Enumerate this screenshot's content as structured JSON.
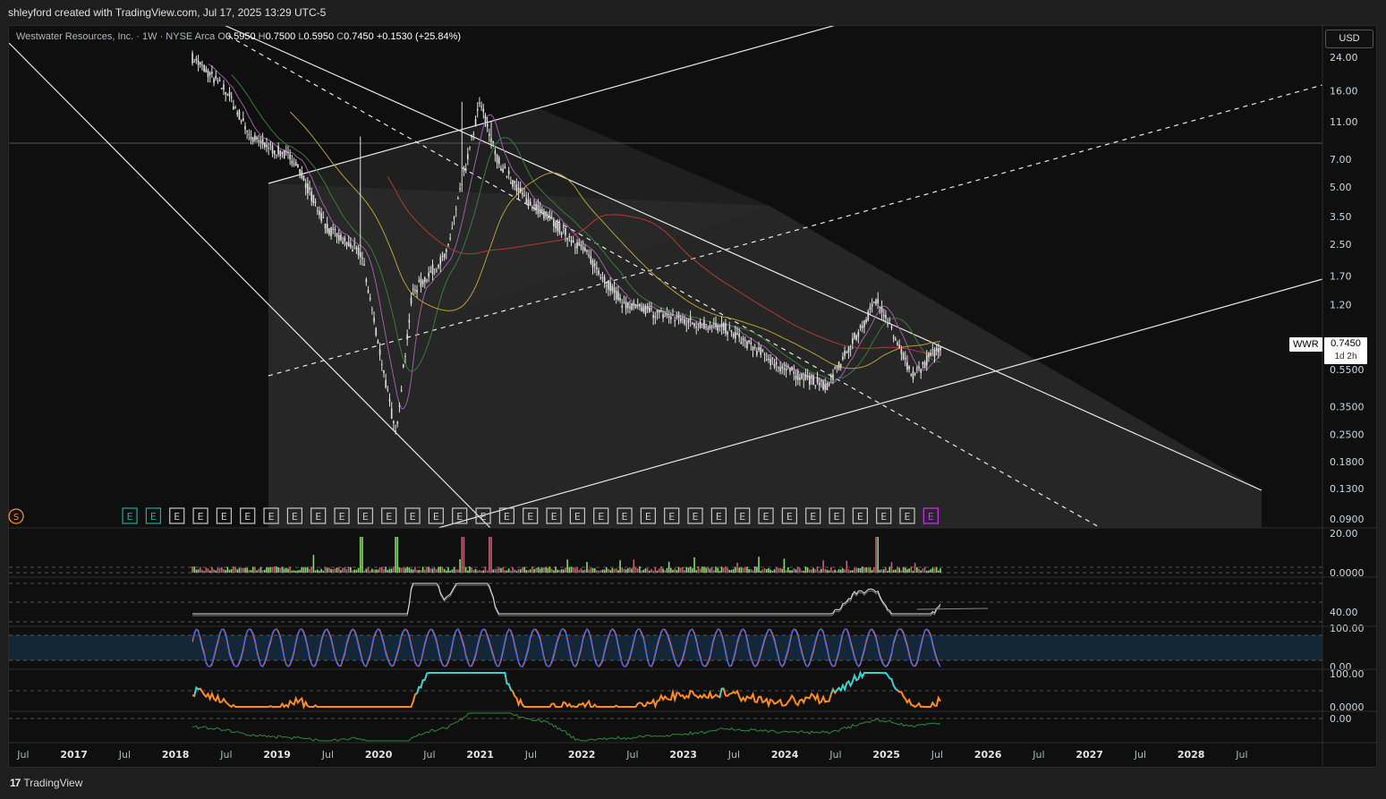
{
  "header": {
    "credit": "shleyford created with TradingView.com, Jul 17, 2025 13:29 UTC-5"
  },
  "legend": {
    "name": "Westwater Resources, Inc. · 1W · NYSE Arca",
    "o_label": "O",
    "o": "0.5950",
    "h_label": "H",
    "h": "0.7500",
    "l_label": "L",
    "l": "0.5950",
    "c_label": "C",
    "c": "0.7450",
    "change": "+0.1530 (+25.84%)"
  },
  "currency_button": "USD",
  "price_tag": {
    "symbol": "WWR",
    "price": "0.7450",
    "countdown": "1d 2h"
  },
  "footer": {
    "brand": "TradingView",
    "brand_mark_icon": "tradingview-logo-icon"
  },
  "colors": {
    "background": "#0f0f0f",
    "channel_fill": "#262626",
    "candle": "#e0e0e0",
    "ma_fast": "#9c5fa8",
    "ma_mid": "#3b7a3b",
    "ma_slow": "#b7a032",
    "ma_long": "#b23a30",
    "stoch_k": "#2962ff",
    "stoch_d": "#ff6d1f",
    "osc_high": "#00e5ff",
    "osc_low": "#ff8c1a",
    "volume_up": "#89d86b",
    "earnings_last": "#c040e0"
  },
  "chart_data": {
    "type": "candlestick",
    "symbol": "WWR",
    "interval": "1W",
    "y_scale": "log",
    "ylim": [
      0.08,
      30
    ],
    "y_ticks": [
      "24.00",
      "16.00",
      "11.00",
      "7.00",
      "5.00",
      "3.50",
      "2.50",
      "1.70",
      "1.20",
      "0.5500",
      "0.3500",
      "0.2500",
      "0.1800",
      "0.1300",
      "0.0900"
    ],
    "x_ticks": [
      "Jul",
      "2017",
      "Jul",
      "2018",
      "Jul",
      "2019",
      "Jul",
      "2020",
      "Jul",
      "2021",
      "Jul",
      "2022",
      "Jul",
      "2023",
      "Jul",
      "2024",
      "Jul",
      "2025",
      "Jul",
      "2026",
      "Jul",
      "2027",
      "Jul",
      "2028",
      "Jul"
    ],
    "approx_price_path": [
      {
        "date": "2018-03",
        "price": 24.0
      },
      {
        "date": "2018-07",
        "price": 16.0
      },
      {
        "date": "2018-10",
        "price": 9.0
      },
      {
        "date": "2019-03",
        "price": 7.0
      },
      {
        "date": "2019-07",
        "price": 3.0
      },
      {
        "date": "2019-11",
        "price": 2.2
      },
      {
        "date": "2020-03",
        "price": 0.25
      },
      {
        "date": "2020-05",
        "price": 1.4
      },
      {
        "date": "2020-09",
        "price": 2.2
      },
      {
        "date": "2021-01",
        "price": 14.0
      },
      {
        "date": "2021-03",
        "price": 7.0
      },
      {
        "date": "2021-06",
        "price": 4.5
      },
      {
        "date": "2022-01",
        "price": 2.4
      },
      {
        "date": "2022-06",
        "price": 1.2
      },
      {
        "date": "2023-01",
        "price": 1.0
      },
      {
        "date": "2023-06",
        "price": 0.9
      },
      {
        "date": "2024-01",
        "price": 0.55
      },
      {
        "date": "2024-06",
        "price": 0.45
      },
      {
        "date": "2024-12",
        "price": 1.3
      },
      {
        "date": "2025-04",
        "price": 0.5
      },
      {
        "date": "2025-07",
        "price": 0.745
      }
    ],
    "last": {
      "open": 0.595,
      "high": 0.75,
      "low": 0.595,
      "close": 0.745
    },
    "earnings_markers": 35,
    "panes": [
      {
        "name": "volume",
        "y_ticks": [
          "20.00",
          "0.0000"
        ]
      },
      {
        "name": "oscillator-1",
        "y_ticks": [
          "40.00"
        ]
      },
      {
        "name": "stochastic",
        "y_ticks": [
          "100.00",
          "0.00"
        ]
      },
      {
        "name": "oscillator-2",
        "y_ticks": [
          "100.00",
          "0.0000"
        ]
      },
      {
        "name": "oscillator-3",
        "y_ticks": [
          "0.00"
        ]
      }
    ]
  }
}
